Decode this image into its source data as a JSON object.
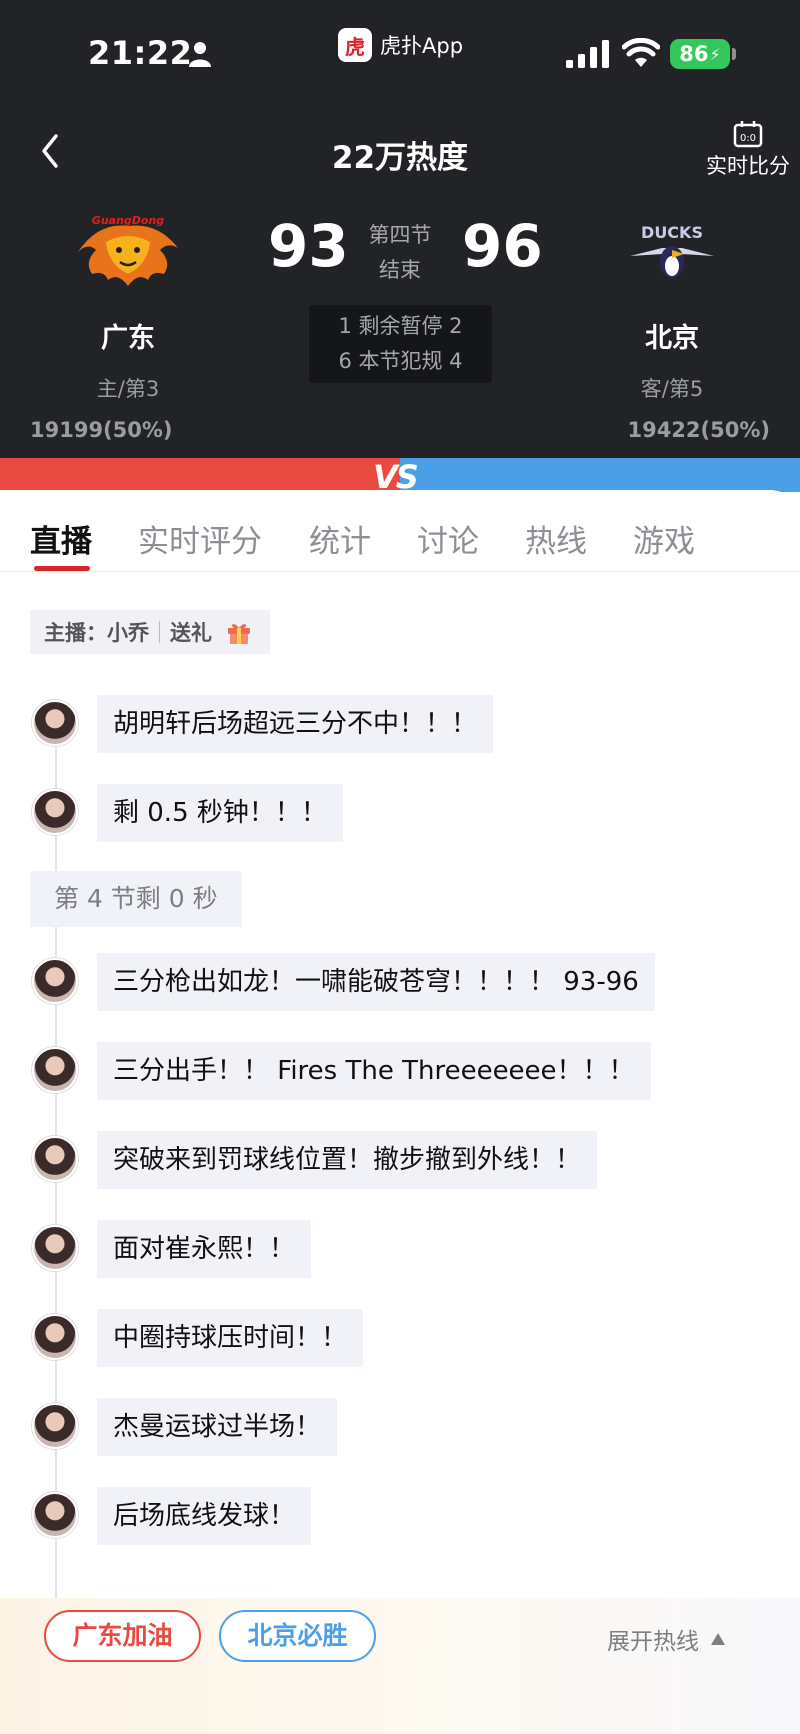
{
  "status_bar": {
    "time": "21:22",
    "app_logo_char": "虎",
    "app_name": "虎扑App",
    "battery": "86"
  },
  "nav": {
    "title": "22万热度",
    "live_score_label": "实时比分"
  },
  "match": {
    "home": {
      "name": "广东",
      "rank": "主/第3",
      "score": "93",
      "support": "19199(50%)"
    },
    "away": {
      "name": "北京",
      "rank": "客/第5",
      "score": "96",
      "support": "19422(50%)"
    },
    "period": "第四节",
    "status": "结束",
    "stats_line1": "1 剩余暂停 2",
    "stats_line2": "6 本节犯规 4",
    "vs_label": "VS"
  },
  "tabs": [
    {
      "label": "直播",
      "active": true
    },
    {
      "label": "实时评分",
      "active": false
    },
    {
      "label": "统计",
      "active": false
    },
    {
      "label": "讨论",
      "active": false
    },
    {
      "label": "热线",
      "active": false
    },
    {
      "label": "游戏",
      "active": false
    }
  ],
  "host": {
    "label": "主播：小乔",
    "gift_label": "送礼"
  },
  "feed": {
    "messages": [
      "胡明轩后场超远三分不中！！！",
      "剩 0.5 秒钟！！！",
      "三分枪出如龙！一啸能破苍穹！！！！ 93-96",
      "三分出手！！ Fires The Threeeeeee！！！",
      "突破来到罚球线位置！撤步撤到外线！！",
      "面对崔永熙！！",
      "中圈持球压时间！！",
      "杰曼运球过半场！",
      "后场底线发球！"
    ],
    "period_marker": "第 4 节剩 0 秒"
  },
  "bottom_bar": {
    "cheer_home": "广东加油",
    "cheer_away": "北京必胜",
    "expand_label": "展开热线"
  },
  "colors": {
    "header_bg": "#222326",
    "home_red": "#e94a40",
    "away_blue": "#4b9fe6",
    "accent": "#d8232a",
    "bubble_bg": "#f1f2f7"
  }
}
